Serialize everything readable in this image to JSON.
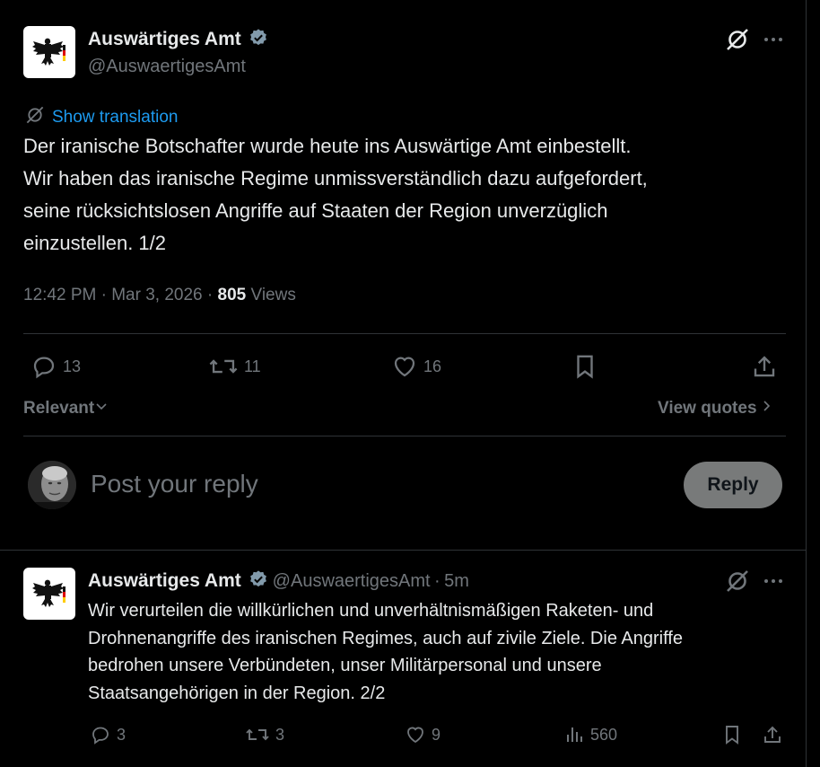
{
  "main_post": {
    "author_name": "Auswärtiges Amt",
    "author_handle": "@AuswaertigesAmt",
    "show_translation": "Show translation",
    "text_lines": [
      "Der iranische Botschafter wurde heute ins Auswärtige Amt einbestellt.",
      "Wir haben das iranische Regime unmissverständlich dazu aufgefordert,",
      "seine rücksichtslosen Angriffe auf Staaten der Region unverzüglich",
      "einzustellen. 1/2"
    ],
    "time": "12:42 PM",
    "date": "Mar 3, 2026",
    "views_count": "805",
    "views_label": "Views",
    "replies": "13",
    "reposts": "11",
    "likes": "16"
  },
  "sort": {
    "label": "Relevant",
    "view_quotes": "View quotes"
  },
  "composer": {
    "placeholder": "Post your reply",
    "reply_button": "Reply"
  },
  "thread_post": {
    "author_name": "Auswärtiges Amt",
    "author_handle": "@AuswaertigesAmt",
    "age": "5m",
    "text_lines": [
      "Wir verurteilen die willkürlichen und unverhältnismäßigen Raketen- und",
      "Drohnenangriffe des iranischen Regimes, auch auf zivile Ziele. Die Angriffe",
      "bedrohen unsere Verbündeten, unser Militärpersonal und unsere",
      "Staatsangehörigen in der Region. 2/2"
    ],
    "replies": "3",
    "reposts": "3",
    "likes": "9",
    "views": "560"
  },
  "colors": {
    "background": "#000000",
    "text": "#e7e9ea",
    "muted": "#71767b",
    "link": "#1d9bf0",
    "divider": "#2f3336",
    "reply_button": "#787a7a"
  },
  "icons": [
    "eagle-logo",
    "verified-badge-icon",
    "grok-icon",
    "more-icon",
    "translate-icon",
    "reply-icon",
    "repost-icon",
    "like-icon",
    "bookmark-icon",
    "share-icon",
    "views-icon",
    "chevron-down-icon",
    "chevron-right-icon"
  ]
}
